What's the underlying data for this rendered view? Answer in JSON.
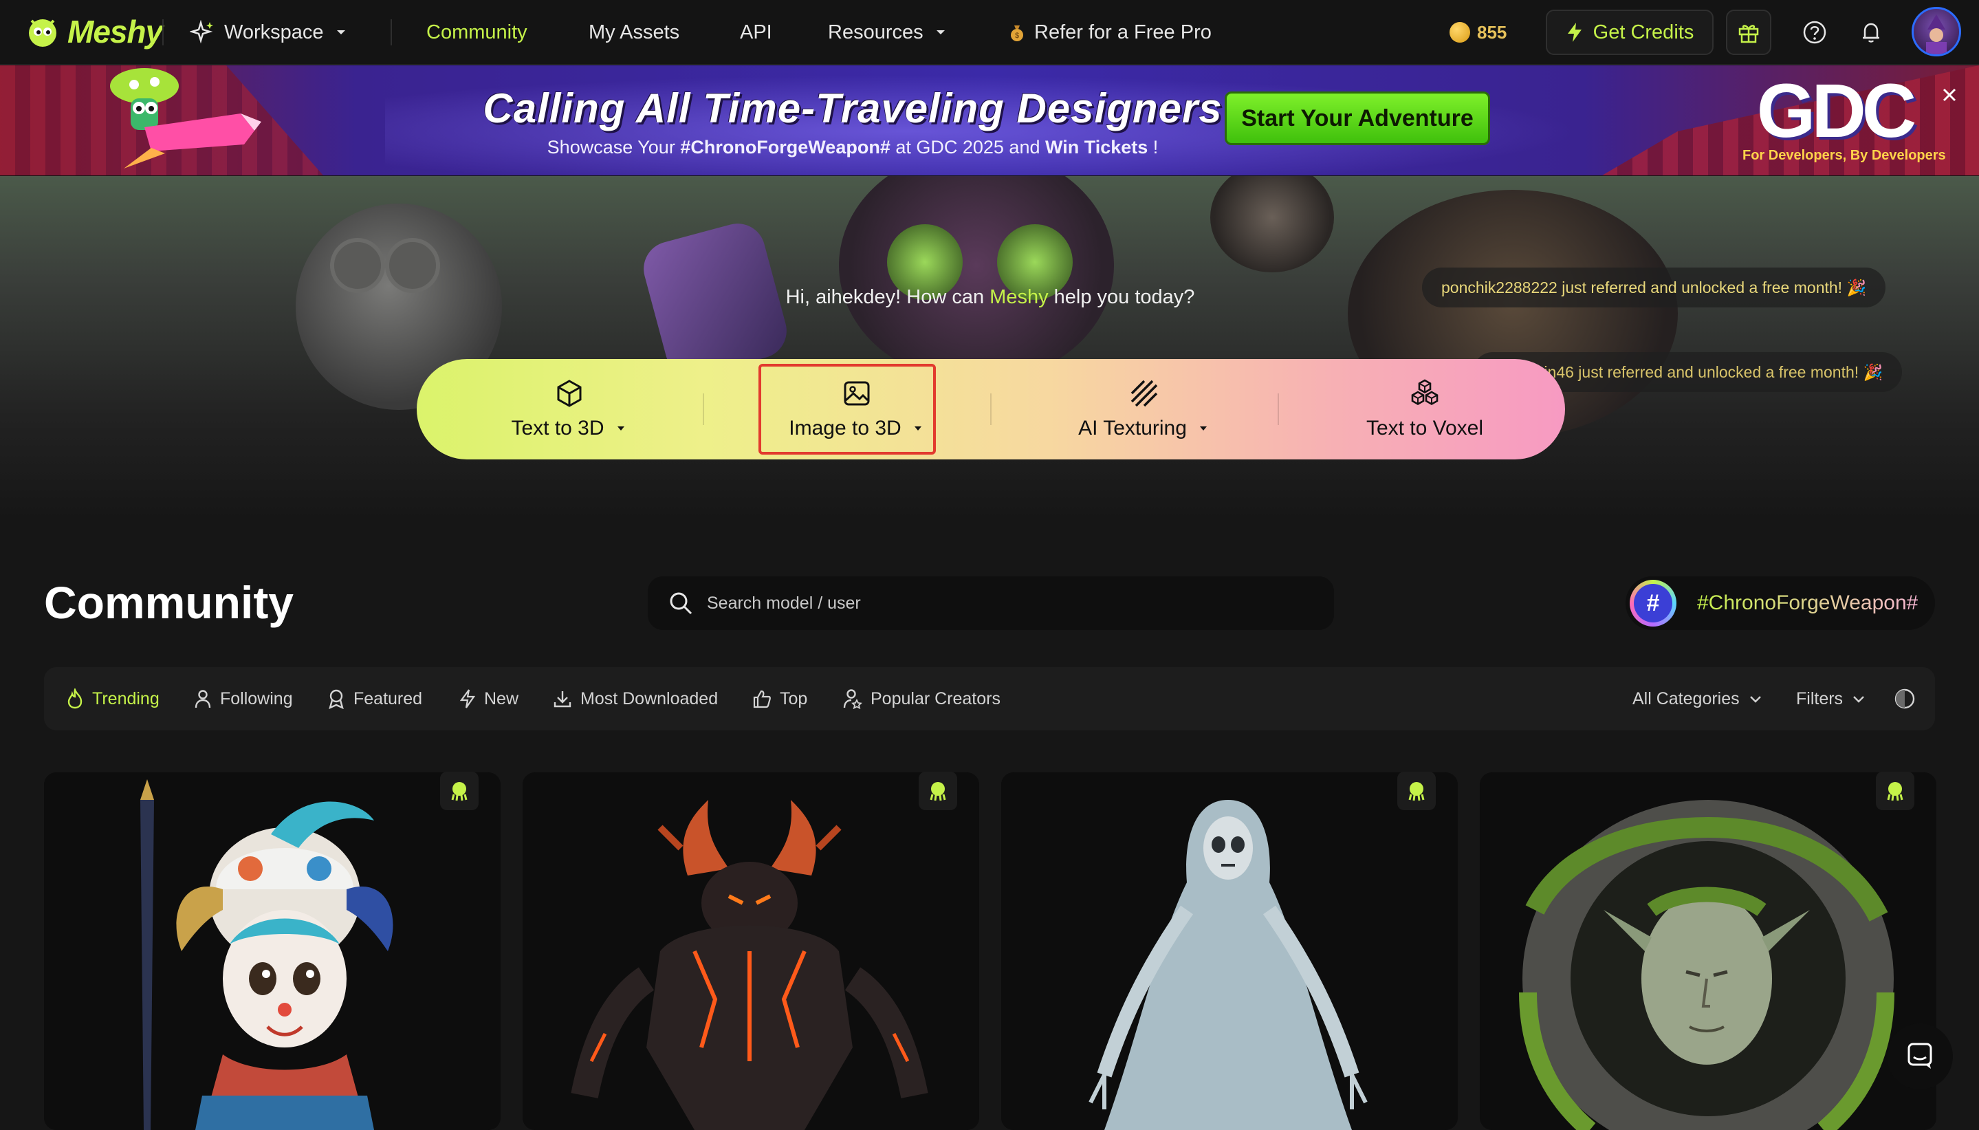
{
  "nav": {
    "logo": "Meshy",
    "workspace": "Workspace",
    "community": "Community",
    "my_assets": "My Assets",
    "api": "API",
    "resources": "Resources",
    "refer": "Refer for a Free Pro",
    "credits": "855",
    "get_credits": "Get Credits"
  },
  "banner": {
    "title": "Calling All Time-Traveling Designers",
    "sub_prefix": "Showcase Your ",
    "sub_hashtag": "#ChronoForgeWeapon#",
    "sub_mid": " at GDC 2025 and ",
    "sub_win": "Win Tickets",
    "sub_suffix": " !",
    "cta": "Start Your Adventure",
    "gdc": "GDC",
    "gdc_tag": "For Developers, By Developers"
  },
  "hero": {
    "greeting_prefix": "Hi, aihekdey! How can ",
    "greeting_brand": "Meshy",
    "greeting_suffix": " help you today?",
    "toasts": [
      "ponchik2288222 just referred and unlocked a free month! 🎉",
      "alp.metin46 just referred and unlocked a free month! 🎉"
    ],
    "tools": [
      {
        "label": "Text to 3D",
        "icon": "cube-icon",
        "dropdown": true
      },
      {
        "label": "Image to 3D",
        "icon": "image-icon",
        "dropdown": true,
        "highlighted": true
      },
      {
        "label": "AI Texturing",
        "icon": "texture-stripes-icon",
        "dropdown": true
      },
      {
        "label": "Text to Voxel",
        "icon": "voxel-cubes-icon",
        "dropdown": false
      }
    ]
  },
  "community": {
    "title": "Community",
    "search_placeholder": "Search model / user",
    "tag": "#ChronoForgeWeapon#",
    "filters": [
      "Trending",
      "Following",
      "Featured",
      "New",
      "Most Downloaded",
      "Top",
      "Popular Creators"
    ],
    "active_filter": "Trending",
    "categories": "All Categories",
    "filters_label": "Filters"
  },
  "cards": [
    {
      "subject": "clown-jester-figure"
    },
    {
      "subject": "lava-demon-creature"
    },
    {
      "subject": "ghost-wraith"
    },
    {
      "subject": "stone-elf-relief"
    }
  ],
  "colors": {
    "accent": "#c5f249",
    "highlight_border": "#e23a2e",
    "background": "#161616"
  }
}
